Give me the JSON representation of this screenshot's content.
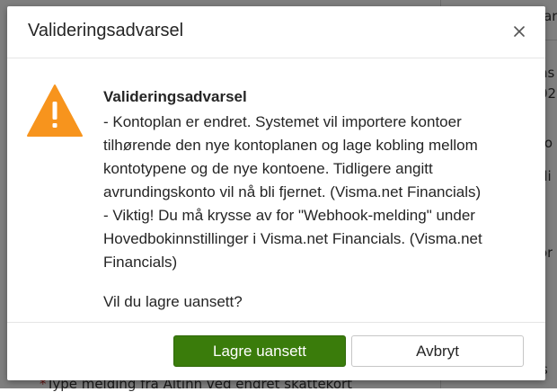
{
  "background": {
    "fragments": [
      "avar",
      "ns",
      "02",
      "to",
      "di",
      "or",
      "s"
    ],
    "footer_required_mark": "*",
    "footer_text": "Type melding fra Altinn ved endret skattekort"
  },
  "dialog": {
    "title": "Valideringsadvarsel",
    "close_icon": "close-icon",
    "warning_icon": "warning-triangle-icon",
    "warning_color": "#f7941d",
    "message": {
      "heading": "Valideringsadvarsel",
      "paragraph_1": "- Kontoplan er endret. Systemet vil importere kontoer tilhørende den nye kontoplanen og lage kobling mellom kontotypene og de nye kontoene. Tidligere angitt avrundingskonto vil nå bli fjernet. (Visma.net Financials)",
      "paragraph_2": "- Viktig! Du må krysse av for \"Webhook-melding\" under Hovedbokinnstillinger i Visma.net Financials. (Visma.net Financials)",
      "question": "Vil du lagre uansett?"
    },
    "buttons": {
      "save_label": "Lagre uansett",
      "cancel_label": "Avbryt"
    },
    "colors": {
      "primary_button": "#3a7c0b"
    }
  }
}
